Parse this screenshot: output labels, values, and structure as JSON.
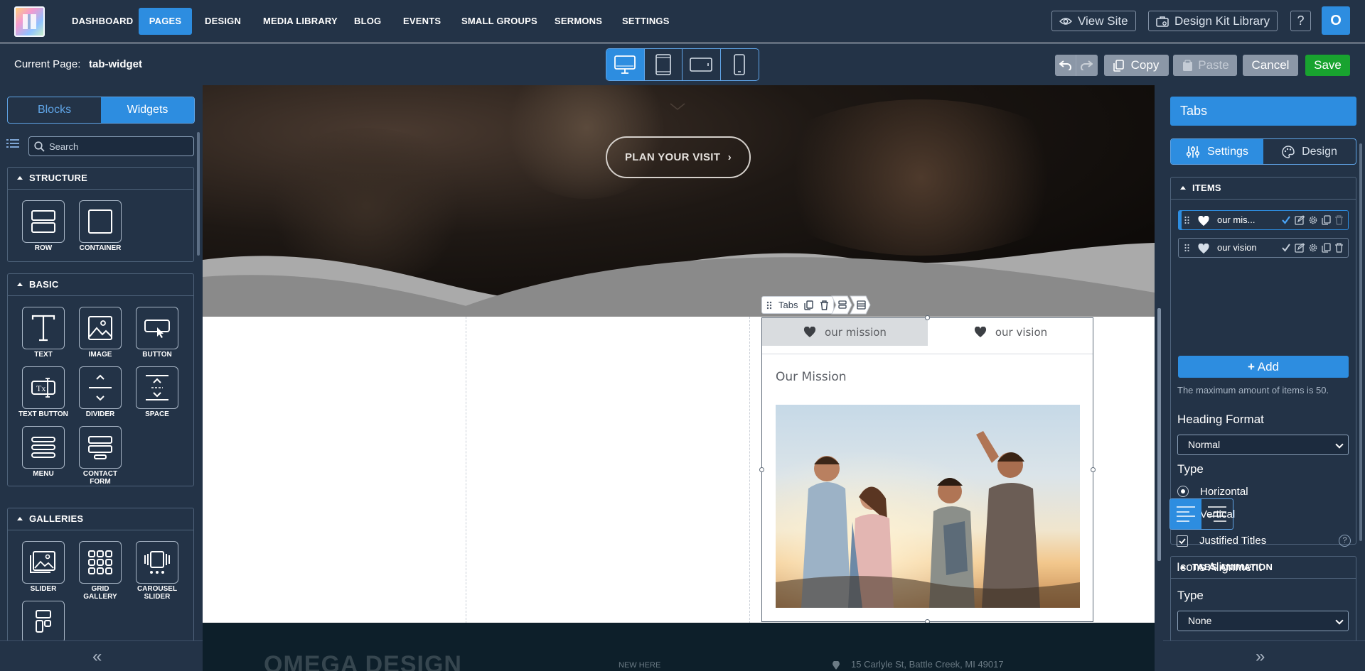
{
  "nav": {
    "items": [
      {
        "label": "DASHBOARD"
      },
      {
        "label": "PAGES",
        "active": true
      },
      {
        "label": "DESIGN"
      },
      {
        "label": "MEDIA LIBRARY"
      },
      {
        "label": "BLOG"
      },
      {
        "label": "EVENTS"
      },
      {
        "label": "SMALL GROUPS"
      },
      {
        "label": "SERMONS"
      },
      {
        "label": "SETTINGS"
      }
    ],
    "view_site": "View Site",
    "design_kit": "Design Kit Library",
    "help": "?",
    "user_initial": "O"
  },
  "toolbar": {
    "current_page_label": "Current Page:",
    "current_page_value": "tab-widget",
    "copy": "Copy",
    "paste": "Paste",
    "cancel": "Cancel",
    "save": "Save",
    "devices": [
      "desktop-icon",
      "tablet-portrait-icon",
      "tablet-landscape-icon",
      "mobile-icon"
    ]
  },
  "left_panel": {
    "tabs": [
      "Blocks",
      "Widgets"
    ],
    "active_tab": "Widgets",
    "search_placeholder": "Search",
    "sections": {
      "structure": {
        "title": "STRUCTURE",
        "widgets": [
          "ROW",
          "CONTAINER"
        ]
      },
      "basic": {
        "title": "BASIC",
        "widgets": [
          "TEXT",
          "IMAGE",
          "BUTTON",
          "TEXT BUTTON",
          "DIVIDER",
          "SPACE",
          "MENU",
          "CONTACT FORM"
        ]
      },
      "galleries": {
        "title": "GALLERIES",
        "widgets": [
          "SLIDER",
          "GRID GALLERY",
          "CAROUSEL SLIDER"
        ]
      }
    }
  },
  "canvas": {
    "hero_button": "PLAN YOUR VISIT",
    "widget_toolbar_label": "Tabs",
    "tabs": [
      {
        "title": "our mission",
        "active": true
      },
      {
        "title": "our vision"
      }
    ],
    "tab_heading": "Our Mission",
    "footer_brand": "OMEGA DESIGN",
    "footer_new": "NEW HERE",
    "footer_address": "15 Carlyle St, Battle Creek, MI 49017"
  },
  "right_panel": {
    "title": "Tabs",
    "tabs": [
      "Settings",
      "Design"
    ],
    "items_title": "ITEMS",
    "items": [
      {
        "label": "our mis...",
        "selected": true
      },
      {
        "label": "our vision"
      }
    ],
    "add": "Add",
    "max_note": "The maximum amount of items is 50.",
    "heading_format_label": "Heading Format",
    "heading_format_value": "Normal",
    "type_label": "Type",
    "type_options": [
      "Horizontal",
      "Vertical"
    ],
    "type_selected": "Horizontal",
    "justified_titles": "Justified Titles",
    "justified_checked": true,
    "icons_alignment_label": "Icons Alignment",
    "icons_alignment": "left",
    "animation_title": "TABS ANIMATION",
    "animation_type_label": "Type",
    "animation_type_value": "None"
  },
  "colors": {
    "accent": "#2d8de0",
    "panel": "#233347",
    "save": "#18a32f"
  }
}
